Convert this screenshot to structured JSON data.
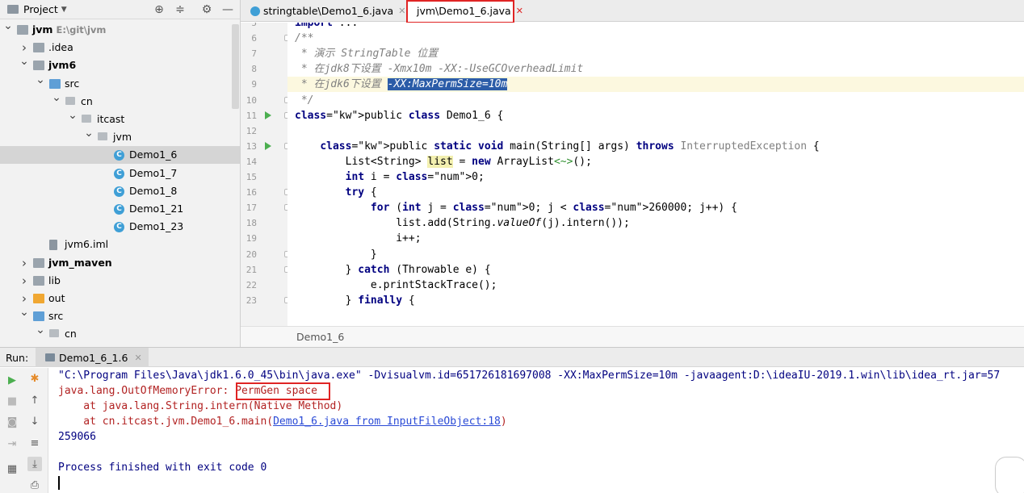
{
  "project": {
    "title": "Project",
    "tree": [
      {
        "label": "jvm",
        "path": "E:\\git\\jvm",
        "bold": true,
        "arrow": "down",
        "icon": "folder-grey",
        "depth": 0
      },
      {
        "label": ".idea",
        "arrow": "right",
        "icon": "folder-grey",
        "depth": 1
      },
      {
        "label": "jvm6",
        "bold": true,
        "arrow": "down",
        "icon": "folder-grey",
        "depth": 1
      },
      {
        "label": "src",
        "arrow": "down",
        "icon": "folder-blue",
        "depth": 2
      },
      {
        "label": "cn",
        "arrow": "down",
        "icon": "pkg",
        "depth": 3
      },
      {
        "label": "itcast",
        "arrow": "down",
        "icon": "pkg",
        "depth": 4
      },
      {
        "label": "jvm",
        "arrow": "down",
        "icon": "pkg",
        "depth": 5
      },
      {
        "label": "Demo1_6",
        "icon": "class",
        "depth": 6,
        "selected": true
      },
      {
        "label": "Demo1_7",
        "icon": "class",
        "depth": 6
      },
      {
        "label": "Demo1_8",
        "icon": "class",
        "depth": 6
      },
      {
        "label": "Demo1_21",
        "icon": "class",
        "depth": 6
      },
      {
        "label": "Demo1_23",
        "icon": "class",
        "depth": 6
      },
      {
        "label": "jvm6.iml",
        "icon": "iml",
        "depth": 2
      },
      {
        "label": "jvm_maven",
        "bold": true,
        "arrow": "right",
        "icon": "folder-grey",
        "depth": 1
      },
      {
        "label": "lib",
        "arrow": "right",
        "icon": "folder-grey",
        "depth": 1
      },
      {
        "label": "out",
        "arrow": "right",
        "icon": "folder-orange",
        "depth": 1
      },
      {
        "label": "src",
        "arrow": "down",
        "icon": "folder-blue",
        "depth": 1
      },
      {
        "label": "cn",
        "arrow": "down",
        "icon": "pkg",
        "depth": 2
      }
    ]
  },
  "editor": {
    "tabs": [
      {
        "label": "stringtable\\Demo1_6.java",
        "active": false
      },
      {
        "label": "jvm\\Demo1_6.java",
        "active": true
      }
    ],
    "lines": [
      {
        "n": "5",
        "text": "import ..."
      },
      {
        "n": "6",
        "text": "/**"
      },
      {
        "n": "7",
        "text": " * 演示 StringTable 位置"
      },
      {
        "n": "8",
        "text": " * 在jdk8下设置 -Xmx10m -XX:-UseGCOverheadLimit"
      },
      {
        "n": "9",
        "text": " * 在jdk6下设置 ",
        "sel": "-XX:MaxPermSize=10m"
      },
      {
        "n": "10",
        "text": " */"
      },
      {
        "n": "11",
        "text": "public class Demo1_6 {"
      },
      {
        "n": "12",
        "text": ""
      },
      {
        "n": "13",
        "text": "    public static void main(String[] args) throws InterruptedException {"
      },
      {
        "n": "14",
        "text": "        List<String> list = new ArrayList<~>();"
      },
      {
        "n": "15",
        "text": "        int i = 0;"
      },
      {
        "n": "16",
        "text": "        try {"
      },
      {
        "n": "17",
        "text": "            for (int j = 0; j < 260000; j++) {"
      },
      {
        "n": "18",
        "text": "                list.add(String.valueOf(j).intern());"
      },
      {
        "n": "19",
        "text": "                i++;"
      },
      {
        "n": "20",
        "text": "            }"
      },
      {
        "n": "21",
        "text": "        } catch (Throwable e) {"
      },
      {
        "n": "22",
        "text": "            e.printStackTrace();"
      },
      {
        "n": "23",
        "text": "        } finally {"
      }
    ],
    "breadcrumb": "Demo1_6"
  },
  "run": {
    "label": "Run:",
    "tab_label": "Demo1_6_1.6",
    "console": {
      "cmd": "\"C:\\Program Files\\Java\\jdk1.6.0_45\\bin\\java.exe\" -Dvisualvm.id=651726181697008 -XX:MaxPermSize=10m -javaagent:D:\\ideaIU-2019.1.win\\lib\\idea_rt.jar=57",
      "err_prefix": "java.lang.OutOfMemoryError: ",
      "err_msg": "PermGen space",
      "trace1": "    at java.lang.String.intern(Native Method)",
      "trace2_prefix": "    at cn.itcast.jvm.Demo1_6.main(",
      "trace2_link": "Demo1_6.java from InputFileObject:18",
      "trace2_suffix": ")",
      "output": "259066",
      "finished": "Process finished with exit code 0"
    }
  }
}
